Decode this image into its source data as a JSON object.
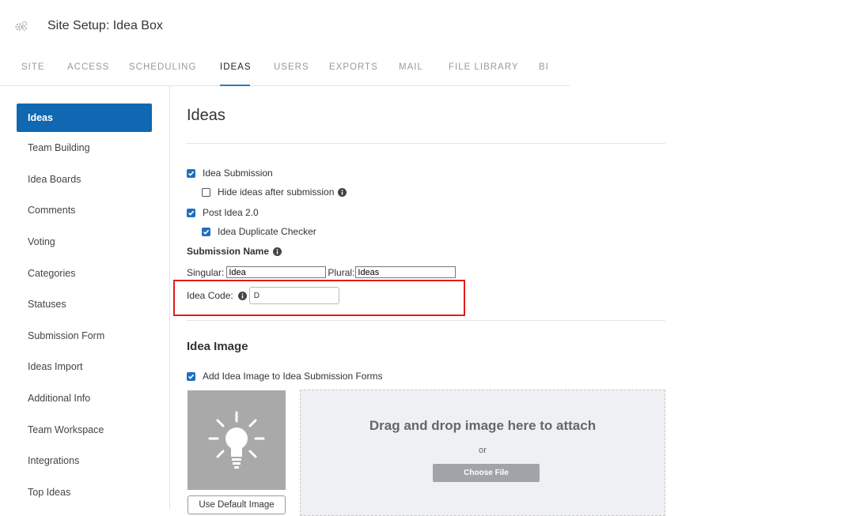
{
  "header": {
    "title": "Site Setup: Idea Box",
    "icon": "gears-icon"
  },
  "tabs": [
    {
      "label": "SITE"
    },
    {
      "label": "ACCESS"
    },
    {
      "label": "SCHEDULING"
    },
    {
      "label": "IDEAS",
      "active": true
    },
    {
      "label": "USERS"
    },
    {
      "label": "EXPORTS"
    },
    {
      "label": "MAIL"
    },
    {
      "label": "FILE LIBRARY"
    },
    {
      "label": "BI"
    }
  ],
  "sidebar": {
    "items": [
      {
        "label": "Ideas",
        "active": true
      },
      {
        "label": "Team Building"
      },
      {
        "label": "Idea Boards"
      },
      {
        "label": "Comments"
      },
      {
        "label": "Voting"
      },
      {
        "label": "Categories"
      },
      {
        "label": "Statuses"
      },
      {
        "label": "Submission Form"
      },
      {
        "label": "Ideas Import"
      },
      {
        "label": "Additional Info"
      },
      {
        "label": "Team Workspace"
      },
      {
        "label": "Integrations"
      },
      {
        "label": "Top Ideas"
      }
    ]
  },
  "main": {
    "title": "Ideas",
    "idea_submission": {
      "label": "Idea Submission",
      "checked": true
    },
    "hide_ideas": {
      "label": "Hide ideas after submission",
      "checked": false
    },
    "post_idea": {
      "label": "Post Idea 2.0",
      "checked": true
    },
    "duplicate_checker": {
      "label": "Idea Duplicate Checker",
      "checked": true
    },
    "submission_name": {
      "label": "Submission Name",
      "singular_label": "Singular:",
      "singular_value": "Idea",
      "plural_label": "Plural:",
      "plural_value": "Ideas"
    },
    "idea_code": {
      "label": "Idea Code:",
      "value": "D"
    },
    "idea_image": {
      "title": "Idea Image",
      "add_label": "Add Idea Image to Idea Submission Forms",
      "add_checked": true,
      "default_button": "Use Default Image",
      "drop_text": "Drag and drop image here to attach",
      "or_text": "or",
      "choose_button": "Choose File"
    }
  },
  "colors": {
    "accent": "#0f68b1",
    "tab_underline": "#2b7bc3",
    "highlight": "#e31b1b"
  }
}
